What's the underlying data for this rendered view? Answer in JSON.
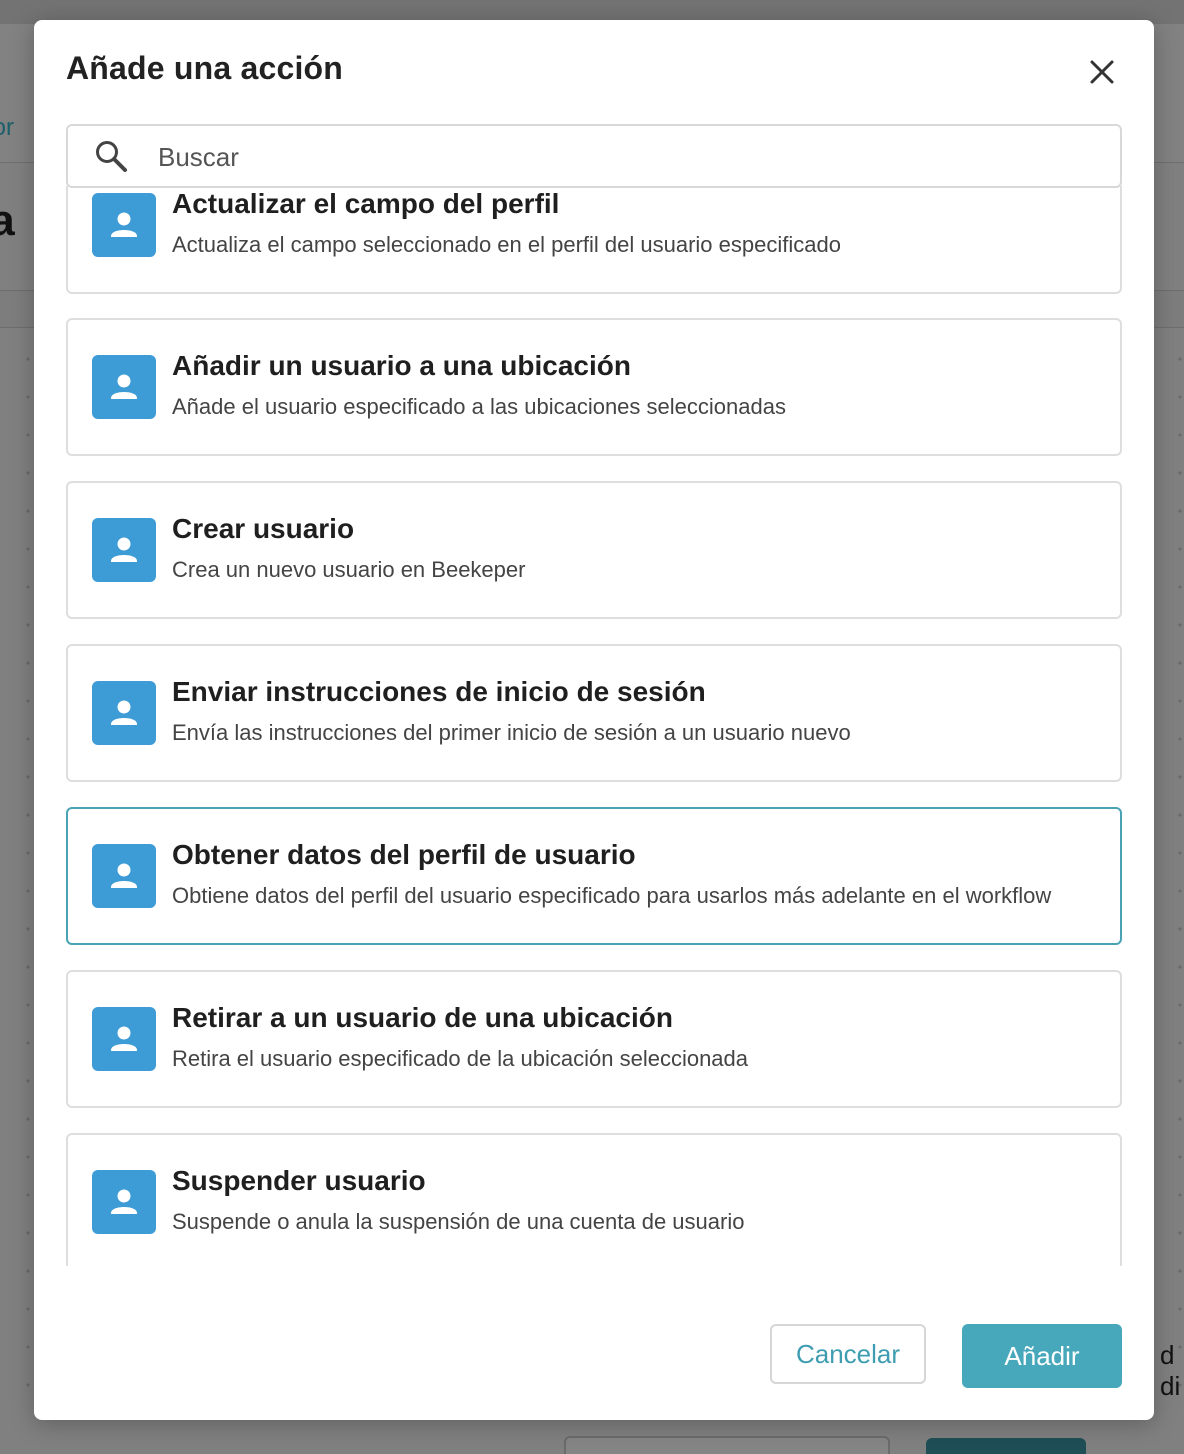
{
  "background": {
    "breadcrumb_fragment": "/or",
    "title_fragment": "/a",
    "side_text_fragment": "d di"
  },
  "modal": {
    "title": "Añade una acción",
    "close_icon": "close-icon",
    "search": {
      "placeholder": "Buscar",
      "value": "",
      "icon": "search-icon"
    },
    "actions": [
      {
        "title": "Actualizar el campo del perfil",
        "description": "Actualiza el campo seleccionado en el perfil del usuario especificado",
        "icon": "user-icon",
        "partially_hidden": true
      },
      {
        "title": "Añadir un usuario a una ubicación",
        "description": "Añade el usuario especificado a las ubicaciones seleccionadas",
        "icon": "user-icon"
      },
      {
        "title": "Crear usuario",
        "description": "Crea un nuevo usuario en Beekeper",
        "icon": "user-icon"
      },
      {
        "title": "Enviar instrucciones de inicio de sesión",
        "description": "Envía las instrucciones del primer inicio de sesión a un usuario nuevo",
        "icon": "user-icon"
      },
      {
        "title": "Obtener datos del perfil de usuario",
        "description": "Obtiene datos del perfil del usuario especificado para usarlos más adelante en el workflow",
        "icon": "user-icon",
        "highlighted": true
      },
      {
        "title": "Retirar a un usuario de una ubicación",
        "description": "Retira el usuario especificado de la ubicación seleccionada",
        "icon": "user-icon"
      },
      {
        "title": "Suspender usuario",
        "description": "Suspende o anula la suspensión de una cuenta de usuario",
        "icon": "user-icon"
      }
    ],
    "buttons": {
      "cancel_label": "Cancelar",
      "add_label": "Añadir"
    }
  },
  "colors": {
    "accent": "#48a8bb",
    "icon_tile": "#3d9bd6",
    "highlight_border": "#4aa3b5",
    "overlay": "#808080"
  }
}
